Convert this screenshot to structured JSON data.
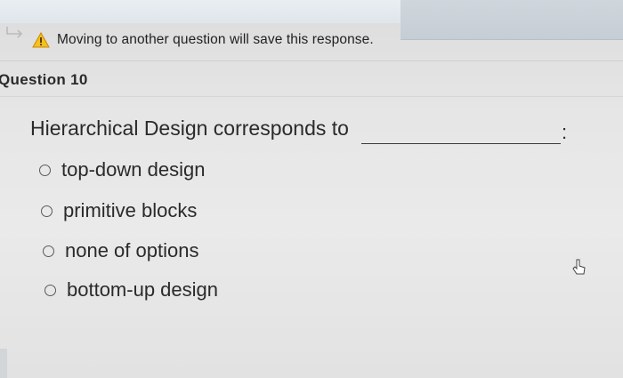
{
  "warning": {
    "icon": "warning-triangle-icon",
    "text": "Moving to another question will save this response."
  },
  "question": {
    "label": "Question 10",
    "prompt": "Hierarchical Design corresponds to",
    "trailing": ":",
    "options": [
      {
        "label": "top-down design",
        "selected": false
      },
      {
        "label": "primitive blocks",
        "selected": false
      },
      {
        "label": "none of options",
        "selected": false
      },
      {
        "label": "bottom-up design",
        "selected": false
      }
    ]
  },
  "colors": {
    "warning_fill": "#f5c020",
    "warning_stroke": "#c98a00",
    "text": "#2a2a2a"
  }
}
